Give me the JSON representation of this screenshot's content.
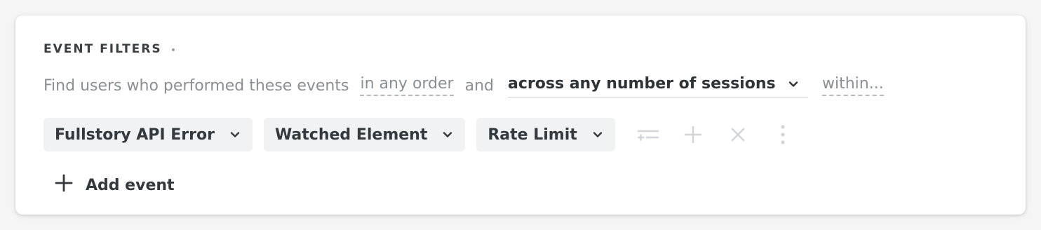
{
  "header": {
    "title": "EVENT FILTERS"
  },
  "sentence": {
    "lead": "Find users who performed these events",
    "order_link": "in any order",
    "conjunction": "and",
    "session_select": "across any number of sessions",
    "within_link": "within..."
  },
  "events": [
    {
      "label": "Fullstory API Error"
    },
    {
      "label": "Watched Element"
    },
    {
      "label": "Rate Limit"
    }
  ],
  "toolbar": {
    "icons": [
      "filter-add-icon",
      "plus-icon",
      "close-icon",
      "more-vertical-icon"
    ]
  },
  "add_event": {
    "label": "Add event"
  },
  "colors": {
    "text_primary": "#34393e",
    "text_muted": "#8a8f94",
    "chip_bg": "#f1f2f3",
    "disabled_icon": "#d3d5d8"
  }
}
